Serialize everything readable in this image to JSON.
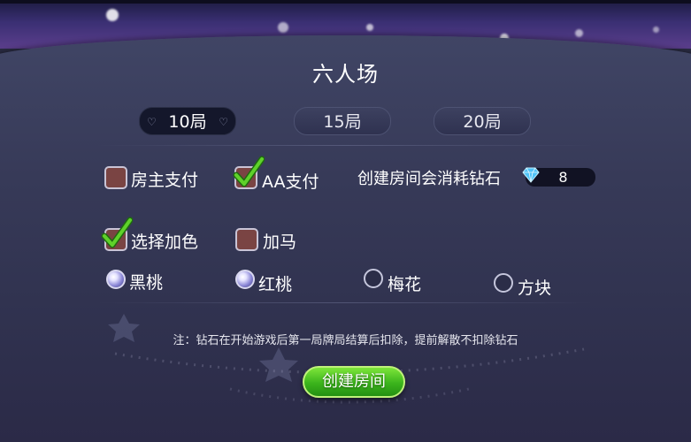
{
  "dialog": {
    "title": "六人场",
    "rounds": [
      {
        "label": "10局",
        "selected": true
      },
      {
        "label": "15局",
        "selected": false
      },
      {
        "label": "20局",
        "selected": false
      }
    ],
    "payment": {
      "owner_pay": {
        "label": "房主支付",
        "checked": false
      },
      "aa_pay": {
        "label": "AA支付",
        "checked": true
      },
      "cost_label": "创建房间会消耗钻石",
      "cost_value": "8",
      "cost_icon": "diamond-icon"
    },
    "options": {
      "choose_color": {
        "label": "选择加色",
        "checked": true
      },
      "add_horse": {
        "label": "加马",
        "checked": false
      }
    },
    "suits": [
      {
        "label": "黑桃",
        "selected": true
      },
      {
        "label": "红桃",
        "selected": true
      },
      {
        "label": "梅花",
        "selected": false
      },
      {
        "label": "方块",
        "selected": false
      }
    ],
    "note": "注：钻石在开始游戏后第一局牌局结算后扣除，提前解散不扣除钻石",
    "create_button": "创建房间"
  },
  "colors": {
    "accent_green": "#3bb41c",
    "checkbox_fill": "#7a4443",
    "check_mark": "#5fd22a",
    "diamond": "#4fc3f7"
  }
}
